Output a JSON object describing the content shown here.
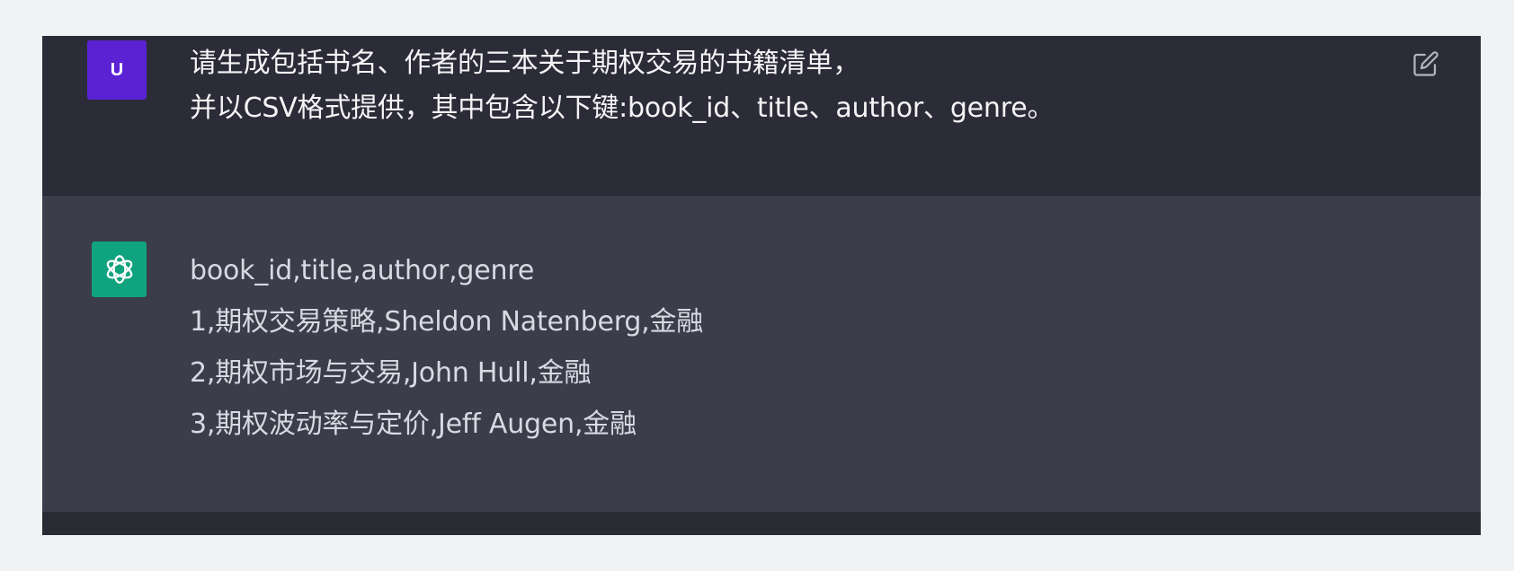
{
  "user_message": {
    "avatar_letter": "U",
    "lines": [
      "请生成包括书名、作者的三本关于期权交易的书籍清单，",
      "并以CSV格式提供，其中包含以下键:book_id、title、author、genre。"
    ],
    "edit_icon": "edit-icon"
  },
  "assistant_message": {
    "avatar_icon": "openai-logo-icon",
    "lines": [
      "book_id,title,author,genre",
      "1,期权交易策略,Sheldon Natenberg,金融",
      "2,期权市场与交易,John Hull,金融",
      "3,期权波动率与定价,Jeff Augen,金融"
    ]
  },
  "colors": {
    "user_avatar": "#5b22d4",
    "assistant_avatar": "#10a37f",
    "user_bg": "#2c2c38",
    "assistant_bg": "#3c3d4b"
  }
}
